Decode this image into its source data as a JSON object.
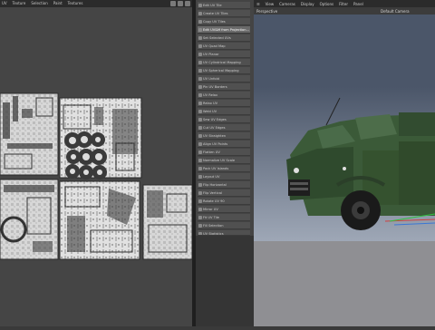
{
  "uv_editor": {
    "menu": [
      "UV",
      "Texture",
      "Selection",
      "Paint",
      "Textures"
    ]
  },
  "command_panel": {
    "items": [
      "Edit UV Tile",
      "Create UV Tiles",
      "Copy UV Tiles",
      "Edit UV&M from Projection...",
      "Set Selected UVs",
      "UV Quad Map",
      "UV Planar",
      "UV Cylindrical Mapping",
      "UV Spherical Mapping",
      "UV Unfold",
      "Pin UV Borders",
      "UV Relax",
      "Relax UV",
      "Weld UV",
      "Sew UV Edges",
      "Cut UV Edges",
      "UV Straighten",
      "Align UV Points",
      "Flatten UV",
      "Normalize UV Scale",
      "Pack UV Islands",
      "Layout UV",
      "Flip Horizontal",
      "Flip Vertical",
      "Rotate UV 90",
      "Mirror UV",
      "Fit UV Tile",
      "Fill Selection",
      "UV Statistics"
    ]
  },
  "viewport": {
    "menu": [
      "View",
      "Cameras",
      "Display",
      "Options",
      "Filter",
      "Panel"
    ],
    "view_name": "Perspective",
    "camera_name": "Default Camera"
  },
  "colors": {
    "sky_top": "#4b5669",
    "sky_bottom": "#9ea7b6",
    "ground": "#8f8f93",
    "vehicle": "#3b5a38"
  }
}
